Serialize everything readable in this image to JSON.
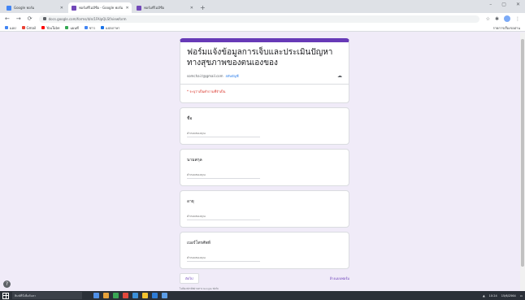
{
  "browser": {
    "tabs": [
      {
        "title": "Google ฟอร์ม",
        "active": false,
        "icon": "docs-icon"
      },
      {
        "title": "ฟอร์มที่ไม่มีชื่อ - Google ฟอร์ม",
        "active": true,
        "icon": "forms-icon"
      },
      {
        "title": "ฟอร์มที่ไม่มีชื่อ",
        "active": false,
        "icon": "forms-icon"
      }
    ],
    "new_tab": "+",
    "window_controls": [
      "–",
      "▢",
      "✕"
    ],
    "address": "docs.google.com/forms/d/e/1FAIpQLSf/viewform",
    "bookmarks": [
      {
        "label": "แอป",
        "color": "#4285f4"
      },
      {
        "label": "Gmail",
        "color": "#ea4335"
      },
      {
        "label": "YouTube",
        "color": "#ff0000"
      },
      {
        "label": "แผนที่",
        "color": "#34a853"
      },
      {
        "label": "ข่าว",
        "color": "#4285f4"
      },
      {
        "label": "แปลภาษา",
        "color": "#1a73e8"
      }
    ],
    "bookmarks_right": "รายการเรื่องรออ่าน"
  },
  "form": {
    "title": "ฟอร์มแจ้งข้อมูลการเจ็บและประเมินปัญหาทางสุขภาพของตนเองของ",
    "account_text": "somchai.t@gmail.com",
    "switch_account": "สลับบัญชี",
    "required_note": "* ระบุว่าเป็นคำถามที่จำเป็น",
    "questions": [
      {
        "label": "ชื่อ",
        "placeholder": "คำตอบของคุณ"
      },
      {
        "label": "นามสกุล",
        "placeholder": "คำตอบของคุณ"
      },
      {
        "label": "อายุ",
        "placeholder": "คำตอบของคุณ"
      },
      {
        "label": "เบอร์โทรศัพท์",
        "placeholder": "คำตอบของคุณ"
      }
    ],
    "next_label": "ถัดไป",
    "clear_label": "ล้างแบบฟอร์ม",
    "footnote": "ไม่ต้องส่งรหัสผ่านทาง Google ฟอร์ม"
  },
  "taskbar": {
    "search_placeholder": "พิมพ์ที่นี่เพื่อค้นหา",
    "apps": [
      "#4f8fe8",
      "#e8a23b",
      "#3aa655",
      "#e2483d",
      "#3c8fd8",
      "#f2c230",
      "#2e7bd6",
      "#5c9ce6"
    ],
    "time": "10:24",
    "date": "15/6/2564"
  },
  "colors": {
    "accent": "#673ab7",
    "page_bg": "#f0ebf8"
  }
}
